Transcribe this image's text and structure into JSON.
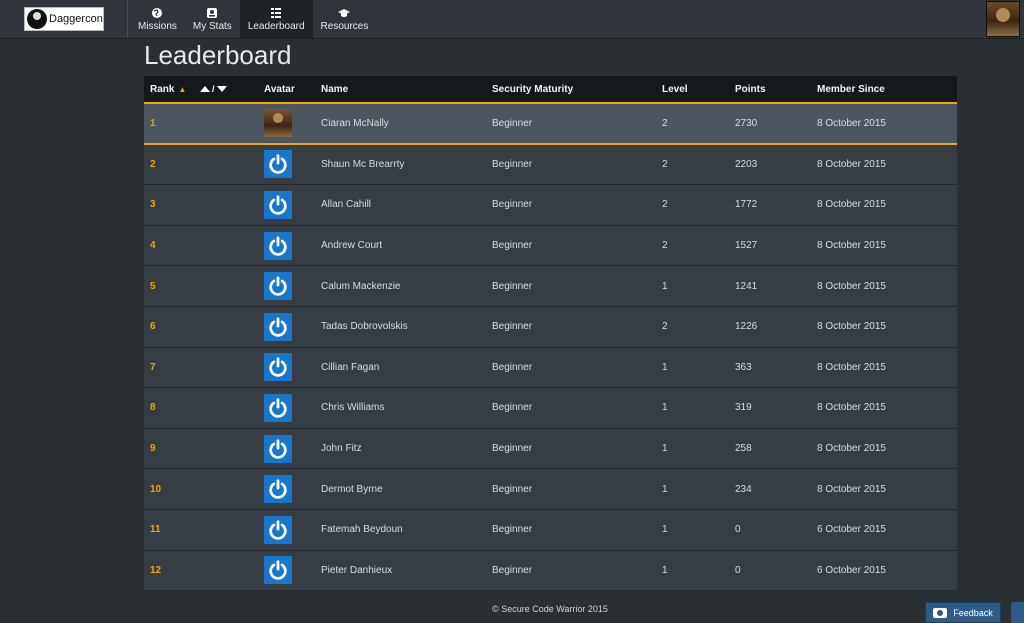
{
  "brand": {
    "name": "Daggercon"
  },
  "nav": {
    "items": [
      {
        "label": "Missions",
        "icon": "globe-icon",
        "active": false
      },
      {
        "label": "My Stats",
        "icon": "stats-icon",
        "active": false
      },
      {
        "label": "Leaderboard",
        "icon": "list-icon",
        "active": true
      },
      {
        "label": "Resources",
        "icon": "graduation-cap-icon",
        "active": false
      }
    ]
  },
  "page": {
    "title": "Leaderboard"
  },
  "table": {
    "headers": {
      "rank": "Rank",
      "rank_sort_indicator": "▲",
      "sort_separator": "/",
      "avatar": "Avatar",
      "name": "Name",
      "maturity": "Security Maturity",
      "level": "Level",
      "points": "Points",
      "since": "Member Since"
    },
    "rows": [
      {
        "rank": "1",
        "avatar": "photo",
        "name": "Ciaran McNally",
        "maturity": "Beginner",
        "level": "2",
        "points": "2730",
        "since": "8 October 2015"
      },
      {
        "rank": "2",
        "avatar": "power-icon",
        "name": "Shaun Mc Brearrty",
        "maturity": "Beginner",
        "level": "2",
        "points": "2203",
        "since": "8 October 2015"
      },
      {
        "rank": "3",
        "avatar": "power-icon",
        "name": "Allan Cahill",
        "maturity": "Beginner",
        "level": "2",
        "points": "1772",
        "since": "8 October 2015"
      },
      {
        "rank": "4",
        "avatar": "power-icon",
        "name": "Andrew Court",
        "maturity": "Beginner",
        "level": "2",
        "points": "1527",
        "since": "8 October 2015"
      },
      {
        "rank": "5",
        "avatar": "power-icon",
        "name": "Calum Mackenzie",
        "maturity": "Beginner",
        "level": "1",
        "points": "1241",
        "since": "8 October 2015"
      },
      {
        "rank": "6",
        "avatar": "power-icon",
        "name": "Tadas Dobrovolskis",
        "maturity": "Beginner",
        "level": "2",
        "points": "1226",
        "since": "8 October 2015"
      },
      {
        "rank": "7",
        "avatar": "power-icon",
        "name": "Cillian Fagan",
        "maturity": "Beginner",
        "level": "1",
        "points": "363",
        "since": "8 October 2015"
      },
      {
        "rank": "8",
        "avatar": "power-icon",
        "name": "Chris Williams",
        "maturity": "Beginner",
        "level": "1",
        "points": "319",
        "since": "8 October 2015"
      },
      {
        "rank": "9",
        "avatar": "power-icon",
        "name": "John Fitz",
        "maturity": "Beginner",
        "level": "1",
        "points": "258",
        "since": "8 October 2015"
      },
      {
        "rank": "10",
        "avatar": "power-icon",
        "name": "Dermot Byrne",
        "maturity": "Beginner",
        "level": "1",
        "points": "234",
        "since": "8 October 2015"
      },
      {
        "rank": "11",
        "avatar": "power-icon",
        "name": "Fatemah Beydoun",
        "maturity": "Beginner",
        "level": "1",
        "points": "0",
        "since": "6 October 2015"
      },
      {
        "rank": "12",
        "avatar": "power-icon",
        "name": "Pieter Danhieux",
        "maturity": "Beginner",
        "level": "1",
        "points": "0",
        "since": "6 October 2015"
      }
    ]
  },
  "footer": {
    "copyright": "© Secure Code Warrior 2015"
  },
  "feedback": {
    "label": "Feedback"
  },
  "colors": {
    "accent": "#f0a500",
    "avatar_blue": "#1877c9",
    "header_bg": "#15191d",
    "row_bg": "#363d45",
    "highlight_bg": "#4d565f"
  }
}
